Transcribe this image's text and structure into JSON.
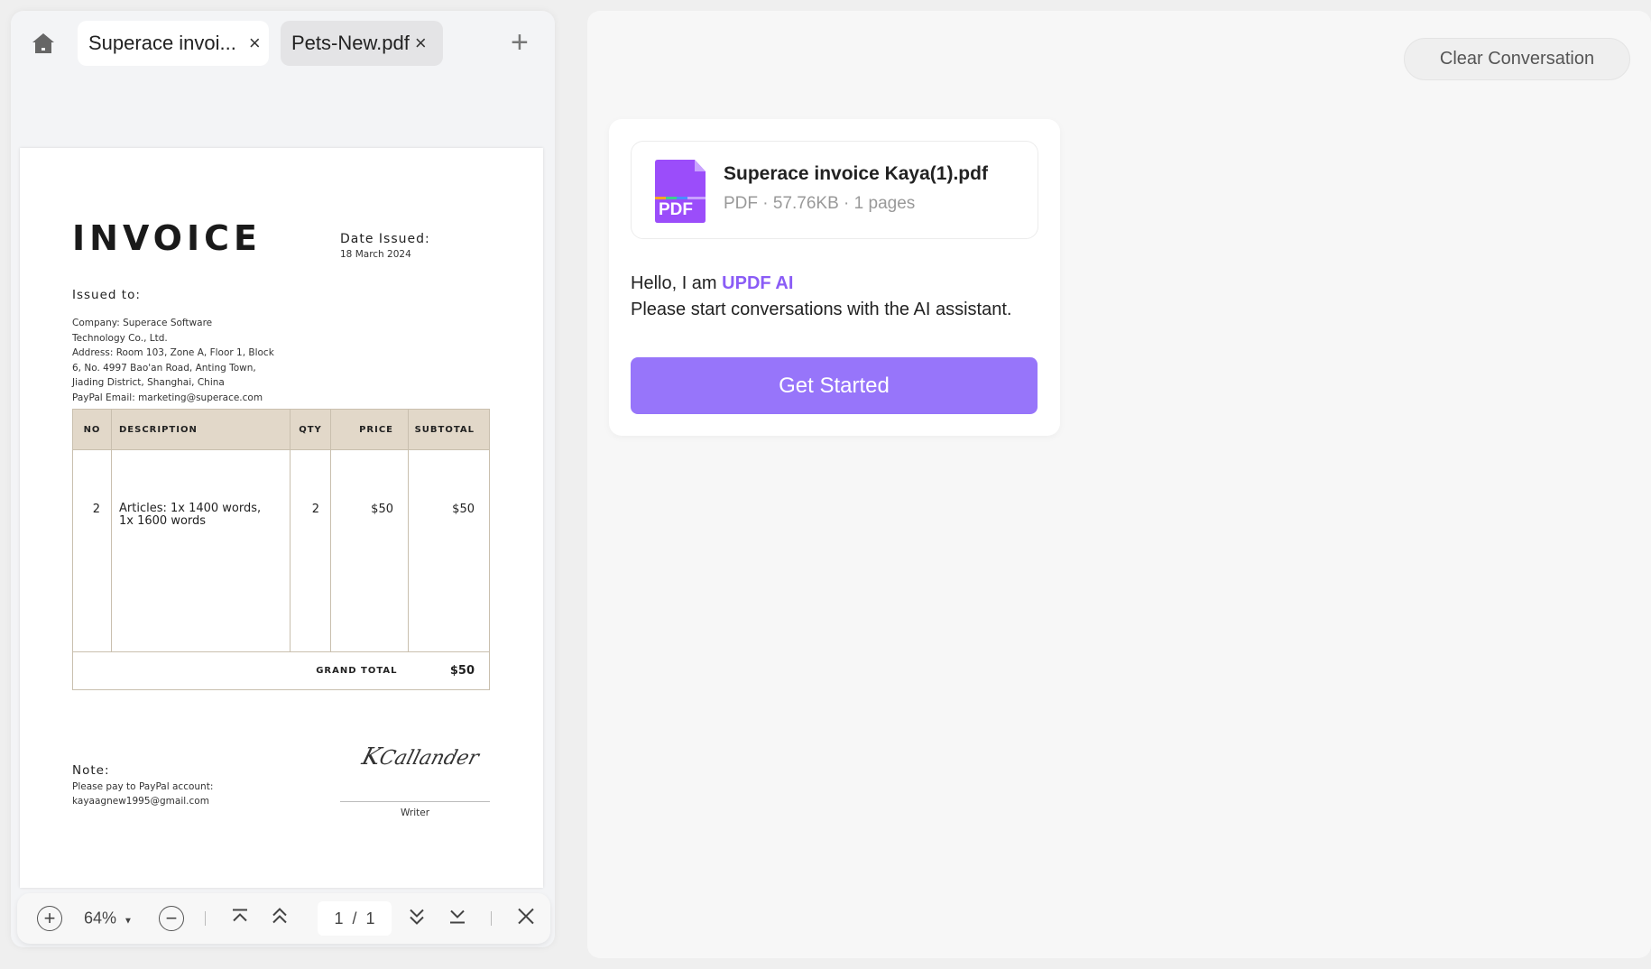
{
  "tabs": {
    "items": [
      {
        "label": "Superace invoi...",
        "active": true
      },
      {
        "label": "Pets-New.pdf",
        "active": false
      }
    ],
    "close": "×",
    "add": "+"
  },
  "invoice": {
    "title": "INVOICE",
    "date_label": "Date Issued:",
    "date": "18 March 2024",
    "issued_to": "Issued to:",
    "address_lines": [
      "Company:  Superace Software",
      "Technology Co., Ltd.",
      "Address: Room 103, Zone A, Floor 1, Block",
      "6, No. 4997 Bao'an Road, Anting Town,",
      "Jiading District, Shanghai, China",
      "PayPal Email: marketing@superace.com"
    ],
    "columns": [
      "NO",
      "DESCRIPTION",
      "QTY",
      "PRICE",
      "SUBTOTAL"
    ],
    "rows": [
      {
        "no": "2",
        "description_1": "Articles: 1x 1400 words,",
        "description_2": "1x  1600 words",
        "qty": "2",
        "price": "$50",
        "subtotal": "$50"
      }
    ],
    "grand_total_label": "GRAND TOTAL",
    "grand_total": "$50",
    "note_label": "Note:",
    "note_line1": "Please pay to PayPal account:",
    "note_line2": "kayaagnew1995@gmail.com",
    "signature": "KCallander",
    "signer": "Writer"
  },
  "toolbar": {
    "zoom": "64%",
    "page_current": "1",
    "page_sep": "/",
    "page_total": "1"
  },
  "chat": {
    "clear_label": "Clear Conversation",
    "file": {
      "name": "Superace invoice Kaya(1).pdf",
      "meta": "PDF · 57.76KB · 1 pages",
      "icon_label": "PDF"
    },
    "greeting_prefix": "Hello, I am ",
    "brand": "UPDF AI",
    "prompt": "Please start conversations with the AI assistant.",
    "start_label": "Get Started",
    "accent": "#9775fa"
  }
}
